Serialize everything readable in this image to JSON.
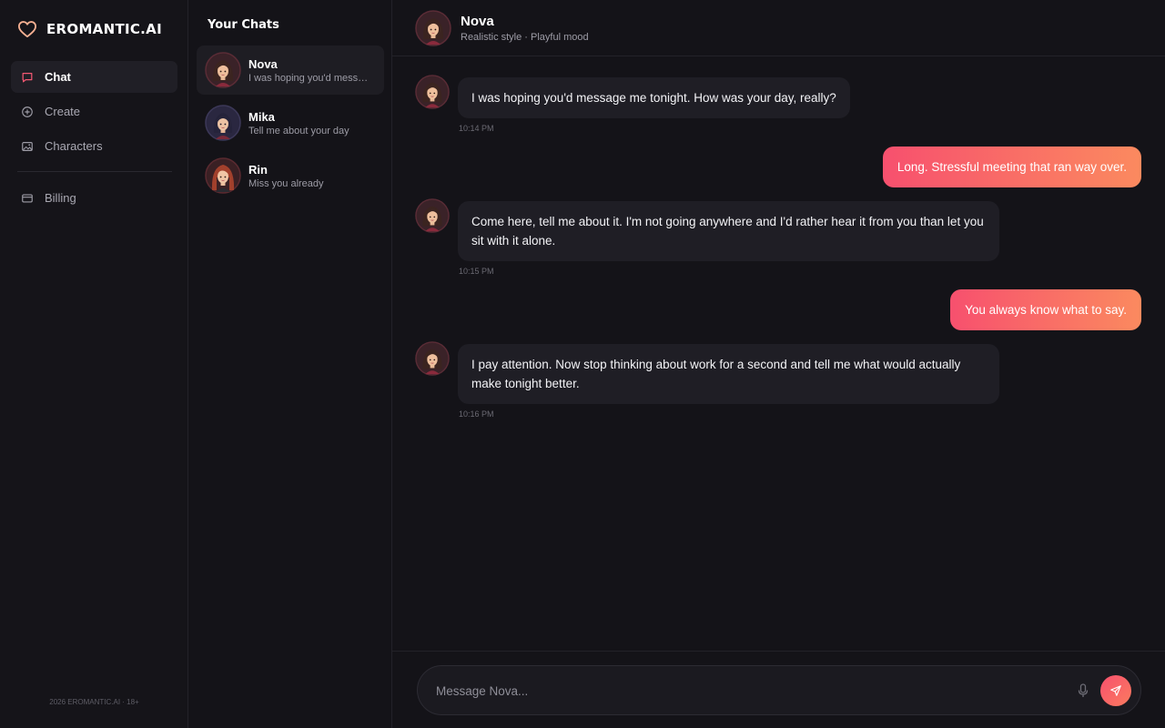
{
  "brand": {
    "name": "EROMANTIC.AI",
    "icon": "heart-icon"
  },
  "nav": {
    "items": [
      {
        "label": "Chat",
        "icon": "chat-bubble-icon",
        "active": true
      },
      {
        "label": "Create",
        "icon": "plus-circle-icon",
        "active": false
      },
      {
        "label": "Characters",
        "icon": "image-icon",
        "active": false
      },
      {
        "label": "Billing",
        "icon": "credit-card-icon",
        "active": false
      }
    ],
    "footer": "2026 EROMANTIC.AI · 18+"
  },
  "chats": {
    "title": "Your Chats",
    "items": [
      {
        "name": "Nova",
        "preview": "I was hoping you'd message me tonight. How was your day, really?",
        "active": true
      },
      {
        "name": "Mika",
        "preview": "Tell me about your day",
        "active": false
      },
      {
        "name": "Rin",
        "preview": "Miss you already",
        "active": false
      }
    ]
  },
  "header": {
    "name": "Nova",
    "subtitle": "Realistic style · Playful mood"
  },
  "messages": [
    {
      "from": "character",
      "text": "I was hoping you'd message me tonight. How was your day, really?",
      "time": "10:14 PM"
    },
    {
      "from": "user",
      "text": "Long. Stressful meeting that ran way over."
    },
    {
      "from": "character",
      "text": "Come here, tell me about it. I'm not going anywhere and I'd rather hear it from you than let you sit with it alone.",
      "time": "10:15 PM"
    },
    {
      "from": "user",
      "text": "You always know what to say."
    },
    {
      "from": "character",
      "text": "I pay attention. Now stop thinking about work for a second and tell me what would actually make tonight better.",
      "time": "10:16 PM"
    }
  ],
  "composer": {
    "placeholder": "Message Nova...",
    "value": "",
    "mic_icon": "microphone-icon",
    "send_icon": "send-icon"
  },
  "colors": {
    "accent_start": "#f7506e",
    "accent_end": "#fb8a5f",
    "background": "#141318",
    "bubble_in": "#1f1e25"
  }
}
